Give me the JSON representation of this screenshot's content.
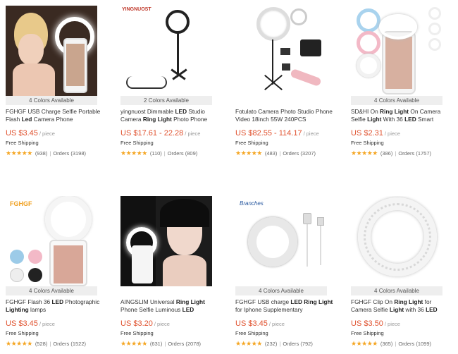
{
  "products": [
    {
      "colors": "4 Colors Available",
      "title_parts": [
        [
          "FGHGF USB Charge Selfie Portable Flash ",
          false
        ],
        [
          "Led",
          true
        ],
        [
          " Camera Phone",
          false
        ]
      ],
      "price": "US $3.45",
      "per": "/ piece",
      "shipping": "Free Shipping",
      "reviews": "(938)",
      "orders": "Orders (3198)",
      "stars": 5
    },
    {
      "colors": "2 Colors Available",
      "title_parts": [
        [
          "yingnuost Dimmable ",
          false
        ],
        [
          "LED",
          true
        ],
        [
          " Studio Camera ",
          false
        ],
        [
          "Ring Light",
          true
        ],
        [
          " Photo Phone",
          false
        ]
      ],
      "price": "US $17.61 - 22.28",
      "per": "/ piece",
      "shipping": "Free Shipping",
      "reviews": "(110)",
      "orders": "Orders (809)",
      "stars": 5,
      "brand_text": "YINGNUOST"
    },
    {
      "colors": "",
      "title_parts": [
        [
          "Fotulato Camera Photo Studio Phone Video 18inch 55W 240PCS",
          false
        ]
      ],
      "price": "US $82.55 - 114.17",
      "per": "/ piece",
      "shipping": "Free Shipping",
      "reviews": "(483)",
      "orders": "Orders (3207)",
      "stars": 5
    },
    {
      "colors": "4 Colors Available",
      "title_parts": [
        [
          "SD&HI On ",
          false
        ],
        [
          "Ring Light",
          true
        ],
        [
          " On Camera Selfie ",
          false
        ],
        [
          "Light",
          true
        ],
        [
          " With 36 ",
          false
        ],
        [
          "LED",
          true
        ],
        [
          " Smart",
          false
        ]
      ],
      "price": "US $2.31",
      "per": "/ piece",
      "shipping": "Free Shipping",
      "reviews": "(386)",
      "orders": "Orders (1757)",
      "stars": 5
    },
    {
      "colors": "4 Colors Available",
      "title_parts": [
        [
          "FGHGF Flash 36 ",
          false
        ],
        [
          "LED",
          true
        ],
        [
          " Photographic ",
          false
        ],
        [
          "Lighting",
          true
        ],
        [
          " lamps",
          false
        ]
      ],
      "price": "US $3.45",
      "per": "/ piece",
      "shipping": "Free Shipping",
      "reviews": "(528)",
      "orders": "Orders (1522)",
      "stars": 5,
      "brand_text": "FGHGF"
    },
    {
      "colors": "",
      "title_parts": [
        [
          "AINGSLIM Universal ",
          false
        ],
        [
          "Ring Light",
          true
        ],
        [
          " Phone Selfie Luminous ",
          false
        ],
        [
          "LED",
          true
        ]
      ],
      "price": "US $3.20",
      "per": "/ piece",
      "shipping": "Free Shipping",
      "reviews": "(631)",
      "orders": "Orders (2078)",
      "stars": 4.5
    },
    {
      "colors": "4 Colors Available",
      "title_parts": [
        [
          "FGHGF USB charge ",
          false
        ],
        [
          "LED Ring Light",
          true
        ],
        [
          " for Iphone Supplementary",
          false
        ]
      ],
      "price": "US $3.45",
      "per": "/ piece",
      "shipping": "Free Shipping",
      "reviews": "(232)",
      "orders": "Orders (792)",
      "stars": 5,
      "brand_text": "Branches"
    },
    {
      "colors": "4 Colors Available",
      "title_parts": [
        [
          "FGHGF Clip On ",
          false
        ],
        [
          "Ring Light",
          true
        ],
        [
          " for Camera Selfie ",
          false
        ],
        [
          "Light",
          true
        ],
        [
          " with 36 ",
          false
        ],
        [
          "LED",
          true
        ]
      ],
      "price": "US $3.50",
      "per": "/ piece",
      "shipping": "Free Shipping",
      "reviews": "(365)",
      "orders": "Orders (1099)",
      "stars": 5
    }
  ]
}
